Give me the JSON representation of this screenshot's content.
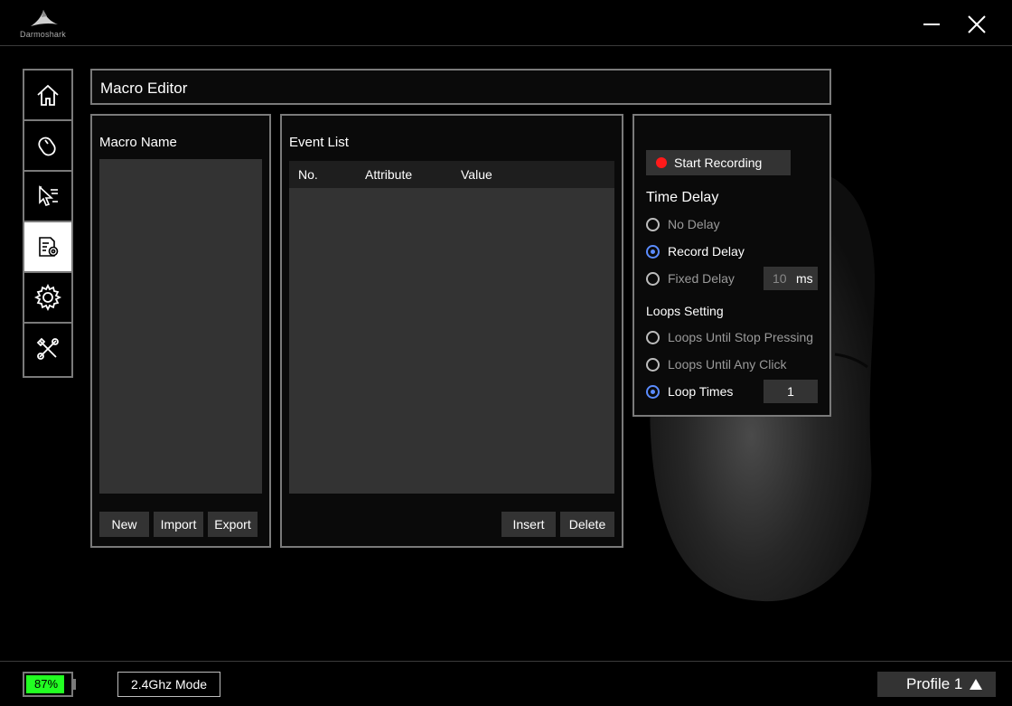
{
  "app": {
    "brand": "Darmoshark"
  },
  "header": {
    "title": "Macro Editor"
  },
  "macro_panel": {
    "title": "Macro Name",
    "buttons": {
      "new": "New",
      "import": "Import",
      "export": "Export"
    }
  },
  "event_panel": {
    "title": "Event List",
    "columns": [
      "No.",
      "Attribute",
      "Value"
    ],
    "buttons": {
      "insert": "Insert",
      "delete": "Delete"
    }
  },
  "record_panel": {
    "start_recording": "Start Recording",
    "time_delay": {
      "title": "Time Delay",
      "options": [
        {
          "label": "No Delay",
          "selected": false
        },
        {
          "label": "Record Delay",
          "selected": true
        },
        {
          "label": "Fixed Delay",
          "selected": false
        }
      ],
      "fixed_value": "10",
      "fixed_unit": "ms"
    },
    "loops": {
      "title": "Loops Setting",
      "options": [
        {
          "label": "Loops Until Stop Pressing",
          "selected": false
        },
        {
          "label": "Loops Until Any Click",
          "selected": false
        },
        {
          "label": "Loop Times",
          "selected": true
        }
      ],
      "loop_times_value": "1"
    }
  },
  "status": {
    "battery_text": "87%",
    "battery_level": 0.87,
    "mode": "2.4Ghz Mode",
    "profile": "Profile 1"
  },
  "colors": {
    "record_dot": "#ff1a1a",
    "radio_selected": "#5b8cff",
    "battery": "#22ff22"
  },
  "icons": {
    "sidebar": [
      "home-icon",
      "mouse-icon",
      "cursor-icon",
      "macro-icon",
      "gear-icon",
      "tools-icon"
    ],
    "window": [
      "minimize-icon",
      "close-icon"
    ],
    "profile": "triangle-up-icon"
  }
}
